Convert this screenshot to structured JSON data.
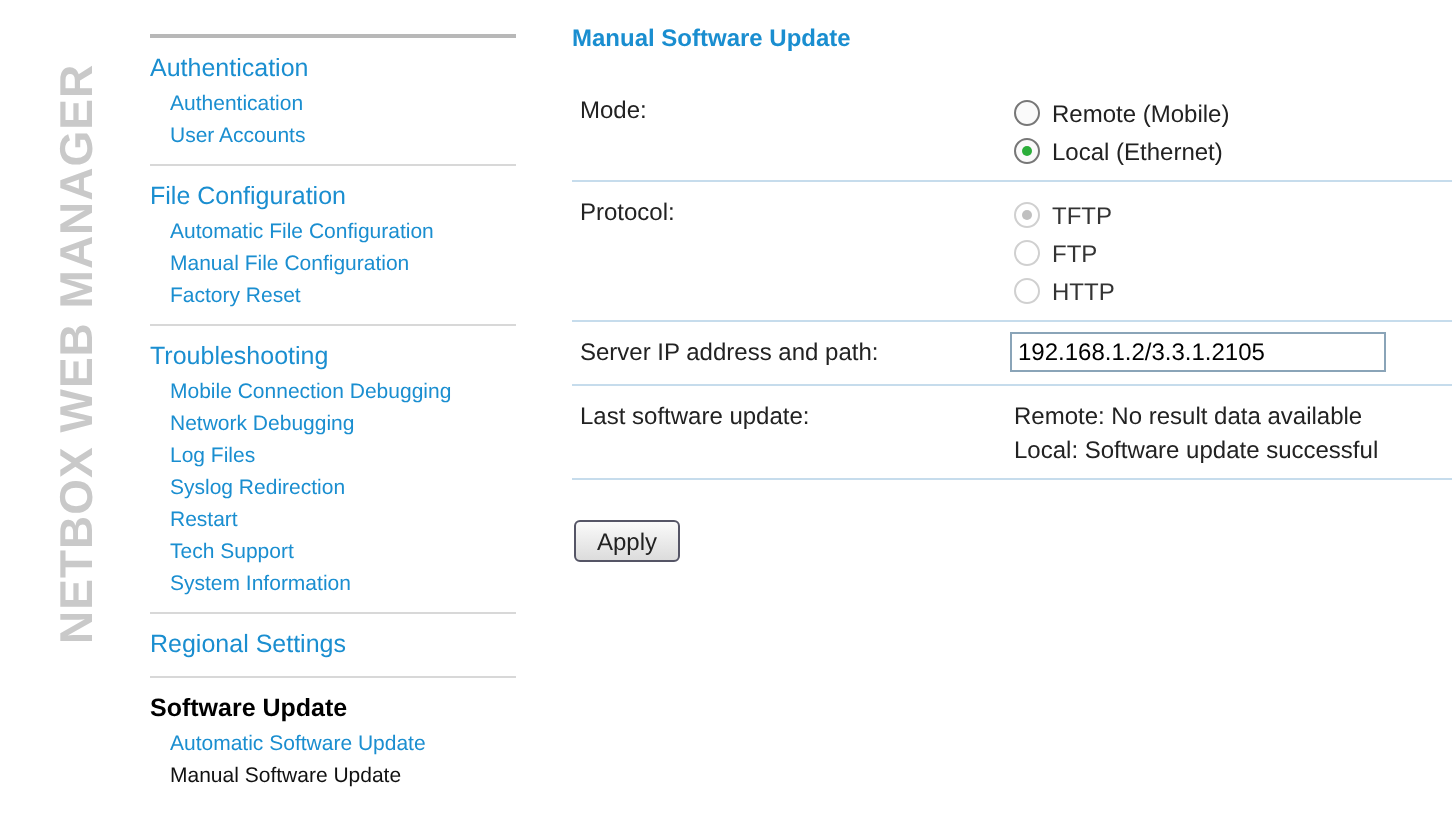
{
  "logo": {
    "text": "NETBOX WEB MANAGER"
  },
  "sidebar": {
    "groups": [
      {
        "heading": "Authentication",
        "selected": false,
        "items": [
          {
            "label": "Authentication",
            "selected": false
          },
          {
            "label": "User Accounts",
            "selected": false
          }
        ]
      },
      {
        "heading": "File Configuration",
        "selected": false,
        "items": [
          {
            "label": "Automatic File Configuration",
            "selected": false
          },
          {
            "label": "Manual File Configuration",
            "selected": false
          },
          {
            "label": "Factory Reset",
            "selected": false
          }
        ]
      },
      {
        "heading": "Troubleshooting",
        "selected": false,
        "items": [
          {
            "label": "Mobile Connection Debugging",
            "selected": false
          },
          {
            "label": "Network Debugging",
            "selected": false
          },
          {
            "label": "Log Files",
            "selected": false
          },
          {
            "label": "Syslog Redirection",
            "selected": false
          },
          {
            "label": "Restart",
            "selected": false
          },
          {
            "label": "Tech Support",
            "selected": false
          },
          {
            "label": "System Information",
            "selected": false
          }
        ]
      },
      {
        "heading": "Regional Settings",
        "selected": false
      },
      {
        "heading": "Software Update",
        "selected": true,
        "items": [
          {
            "label": "Automatic Software Update",
            "selected": false
          },
          {
            "label": "Manual Software Update",
            "selected": true
          }
        ]
      }
    ]
  },
  "main": {
    "title": "Manual Software Update",
    "rows": [
      {
        "kind": "radio",
        "label": "Mode:",
        "options": [
          {
            "label": "Remote (Mobile)",
            "selected": false,
            "disabled": false
          },
          {
            "label": "Local (Ethernet)",
            "selected": true,
            "disabled": false
          }
        ]
      },
      {
        "kind": "radio",
        "label": "Protocol:",
        "options": [
          {
            "label": "TFTP",
            "selected": true,
            "disabled": true
          },
          {
            "label": "FTP",
            "selected": false,
            "disabled": true
          },
          {
            "label": "HTTP",
            "selected": false,
            "disabled": true
          }
        ]
      },
      {
        "kind": "text",
        "label": "Server IP address and path:",
        "value": "192.168.1.2/3.3.1.2105"
      },
      {
        "kind": "info",
        "label": "Last software update:",
        "lines": [
          "Remote: No result data available",
          "Local: Software update successful"
        ]
      }
    ],
    "button": "Apply"
  }
}
